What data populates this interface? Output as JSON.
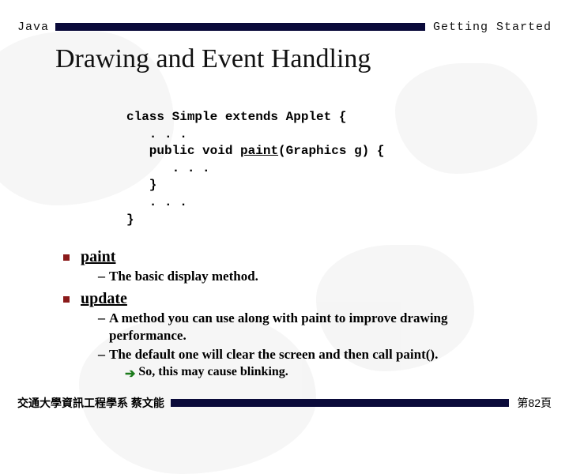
{
  "header": {
    "left": "Java",
    "right": "Getting Started"
  },
  "title": "Drawing and Event Handling",
  "code": {
    "l1a": "class Simple extends Applet {",
    "l2": "   . . .",
    "l3a": "   public void ",
    "l3u": "paint",
    "l3b": "(Graphics g) {",
    "l4": "      . . .",
    "l5": "   }",
    "l6": "   . . .",
    "l7": "}"
  },
  "bullets": {
    "paint": {
      "label": "paint",
      "subs": [
        "The basic display method."
      ]
    },
    "update": {
      "label": "update",
      "subs": [
        "A method you can use along with paint to improve drawing performance.",
        "The default one will clear the screen and then call paint()."
      ],
      "subsub": "So, this may cause blinking."
    }
  },
  "footer": {
    "left": "交通大學資訊工程學系  蔡文能",
    "right": "第82頁"
  }
}
